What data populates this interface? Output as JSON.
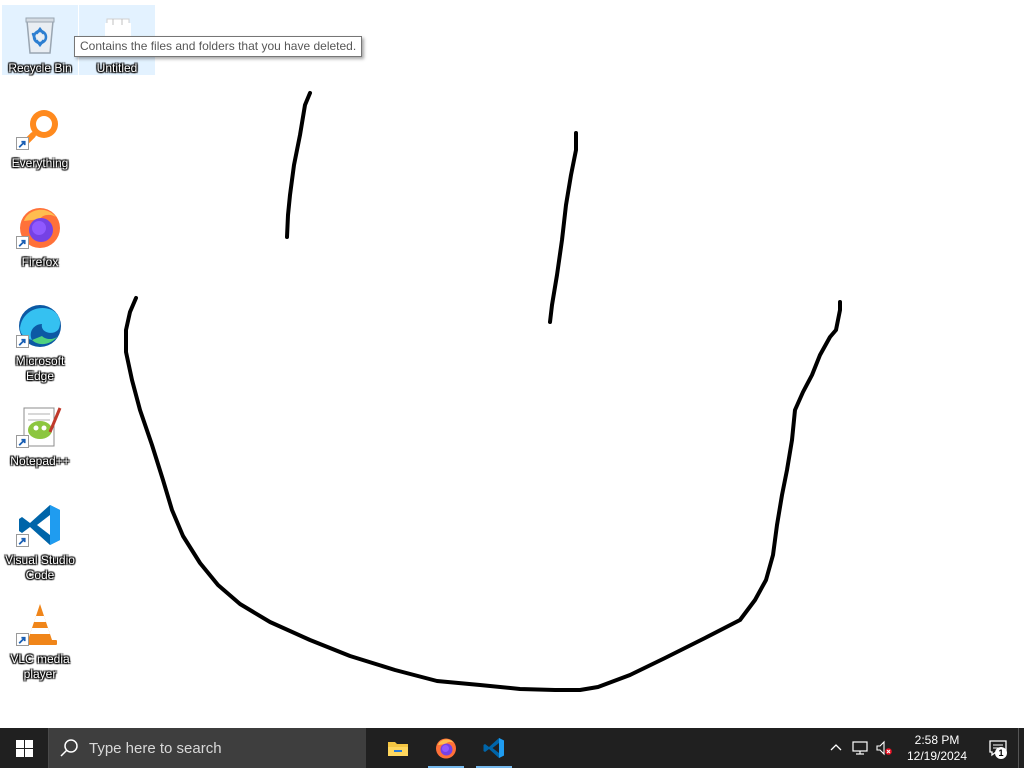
{
  "desktop": {
    "icons": [
      {
        "label": "Recycle Bin",
        "icon": "recycle-bin-icon"
      },
      {
        "label": "Untitled",
        "icon": "untitled-file-icon"
      },
      {
        "label": "Everything",
        "icon": "everything-search-icon"
      },
      {
        "label": "Firefox",
        "icon": "firefox-icon"
      },
      {
        "label": "Microsoft Edge",
        "icon": "edge-icon"
      },
      {
        "label": "Notepad++",
        "icon": "notepad-plus-plus-icon"
      },
      {
        "label": "Visual Studio Code",
        "icon": "vscode-icon"
      },
      {
        "label": "VLC media player",
        "icon": "vlc-icon"
      }
    ],
    "tooltip": "Contains the files and folders that you have deleted."
  },
  "taskbar": {
    "search_placeholder": "Type here to search",
    "pinned": [
      {
        "name": "File Explorer",
        "icon": "folder-icon"
      },
      {
        "name": "Firefox",
        "icon": "firefox-icon"
      },
      {
        "name": "Visual Studio Code",
        "icon": "vscode-icon"
      }
    ],
    "clock": {
      "time": "2:58 PM",
      "date": "12/19/2024"
    },
    "notification_count": "1"
  },
  "colors": {
    "taskbar_bg": "#202020",
    "search_bg": "#3e3e3e",
    "accent_indicator": "#76b9ed",
    "ink": "#000000"
  }
}
